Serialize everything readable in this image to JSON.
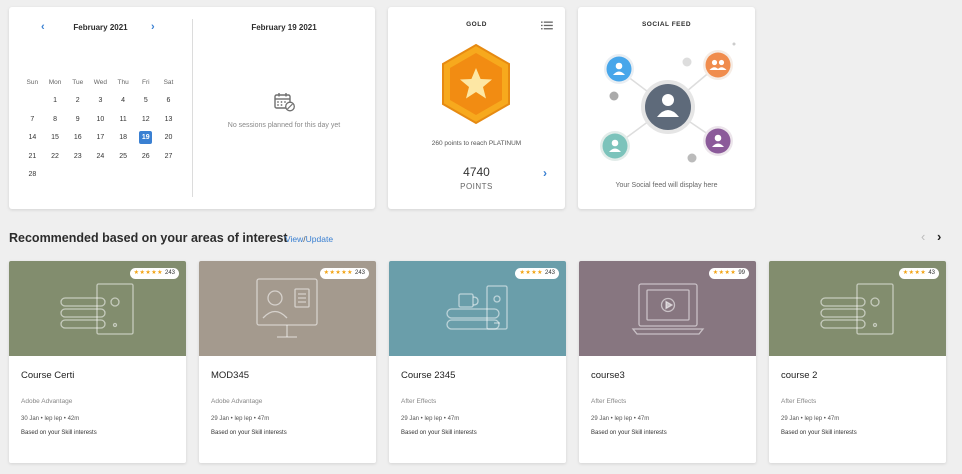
{
  "calendar": {
    "month_label": "February 2021",
    "prev_icon": "chevron-left-icon",
    "next_icon": "chevron-right-icon",
    "weekdays": [
      "Sun",
      "Mon",
      "Tue",
      "Wed",
      "Thu",
      "Fri",
      "Sat"
    ],
    "weeks": [
      [
        "",
        "1",
        "2",
        "3",
        "4",
        "5",
        "6"
      ],
      [
        "7",
        "8",
        "9",
        "10",
        "11",
        "12",
        "13"
      ],
      [
        "14",
        "15",
        "16",
        "17",
        "18",
        "19",
        "20"
      ],
      [
        "21",
        "22",
        "23",
        "24",
        "25",
        "26",
        "27"
      ],
      [
        "28",
        "",
        "",
        "",
        "",
        "",
        ""
      ]
    ],
    "selected_day": "19",
    "selected_color": "#3a80d2",
    "day_title": "February 19 2021",
    "no_sessions_text": "No sessions planned for this day yet"
  },
  "gold": {
    "title": "GOLD",
    "menu_icon": "list-icon",
    "badge_icon": "star-hexagon-icon",
    "reach_text": "260 points to reach PLATINUM",
    "points_value": "4740",
    "points_label": "POINTS",
    "badge_color": "#f5a117"
  },
  "social": {
    "title": "SOCIAL FEED",
    "message": "Your Social feed will display here"
  },
  "section": {
    "title": "Recommended based on your areas of interest",
    "view_label": "View",
    "update_label": "Update"
  },
  "courses": [
    {
      "title": "Course Certi",
      "source": "Adobe Advantage",
      "meta": "30 Jan • lep lep • 42m",
      "basis": "Based on your Skill interests",
      "rating_count": "243",
      "stars": "★★★★★",
      "bg": "#828d6e",
      "icon": "server-stack-icon"
    },
    {
      "title": "MOD345",
      "source": "Adobe Advantage",
      "meta": "29 Jan • lep lep • 47m",
      "basis": "Based on your Skill interests",
      "rating_count": "243",
      "stars": "★★★★★",
      "bg": "#a49a8e",
      "icon": "presentation-screen-icon"
    },
    {
      "title": "Course 2345",
      "source": "After Effects",
      "meta": "29 Jan • lep lep • 47m",
      "basis": "Based on your Skill interests",
      "rating_count": "243",
      "stars": "★★★★",
      "bg": "#6a9eaa",
      "icon": "books-mug-icon"
    },
    {
      "title": "course3",
      "source": "After Effects",
      "meta": "29 Jan • lep lep • 47m",
      "basis": "Based on your Skill interests",
      "rating_count": "99",
      "stars": "★★★★",
      "bg": "#877680",
      "icon": "laptop-video-icon"
    },
    {
      "title": "course 2",
      "source": "After Effects",
      "meta": "29 Jan • lep lep • 47m",
      "basis": "Based on your Skill interests",
      "rating_count": "43",
      "stars": "★★★★",
      "bg": "#828d6e",
      "icon": "server-stack-icon"
    }
  ]
}
